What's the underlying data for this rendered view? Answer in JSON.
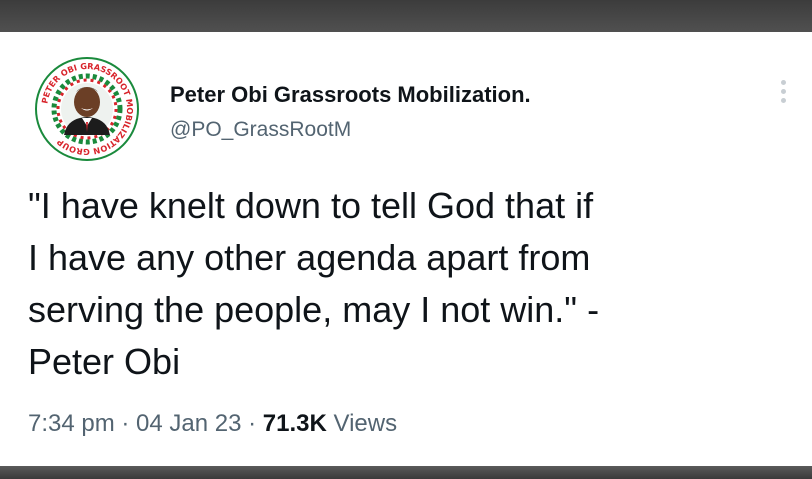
{
  "tweet": {
    "display_name": "Peter Obi Grassroots Mobilization.",
    "handle": "@PO_GrassRootM",
    "text": "\"I have knelt down to tell God that if\nI have any other agenda apart from\nserving the people, may I not win.\" -\nPeter Obi",
    "time": "7:34 pm",
    "date": "04 Jan 23",
    "views_count": "71.3K",
    "views_label": "Views",
    "separator": " · "
  },
  "avatar": {
    "ring_text": "PETER OBI GRASSROOT MOBILIZATION GROUP",
    "colors": {
      "green": "#1a8a3c",
      "red": "#d8242b",
      "skin": "#6b3f26"
    }
  },
  "icons": {
    "more": "more-vertical-icon"
  },
  "colors": {
    "text_primary": "#0f1419",
    "text_secondary": "#536471",
    "background": "#ffffff"
  }
}
